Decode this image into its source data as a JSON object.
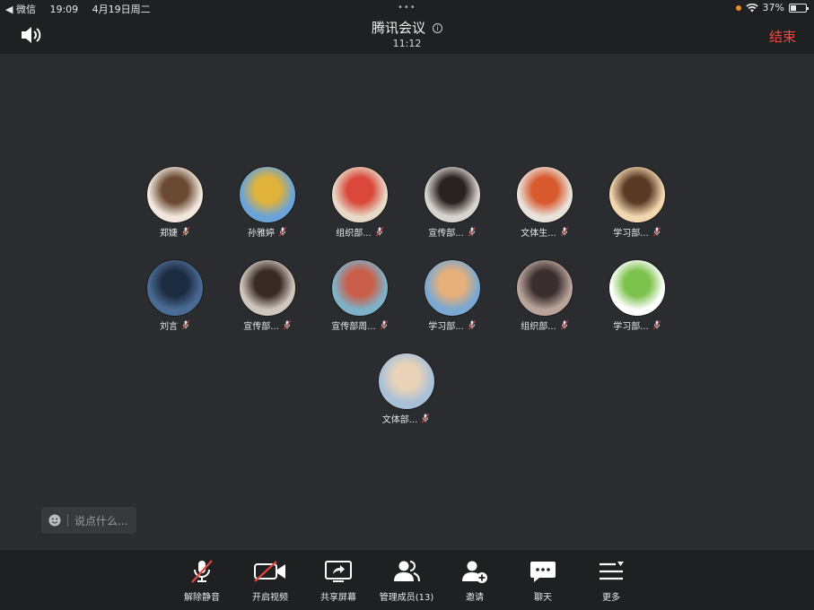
{
  "status_bar": {
    "app": "◀ 微信",
    "time": "19:09",
    "date": "4月19日周二",
    "battery": "37%",
    "battery_level": 0.37
  },
  "header": {
    "title": "腾讯会议",
    "timer": "11:12",
    "end_label": "结束"
  },
  "participants": [
    {
      "name": "郑婕",
      "colors": [
        "#f1e7dc",
        "#6b4a34"
      ]
    },
    {
      "name": "孙雅婷",
      "colors": [
        "#6aa3d8",
        "#e0b23a"
      ]
    },
    {
      "name": "组织部...",
      "colors": [
        "#e8d9c8",
        "#d9483a"
      ]
    },
    {
      "name": "宣传部...",
      "colors": [
        "#d8d4d0",
        "#2a2220"
      ]
    },
    {
      "name": "文体生...",
      "colors": [
        "#e8e2da",
        "#d85a2e"
      ]
    },
    {
      "name": "学习部...",
      "colors": [
        "#f2d7b0",
        "#5a3a24"
      ]
    },
    {
      "name": "刘言",
      "colors": [
        "#4a6b94",
        "#1d2b40"
      ]
    },
    {
      "name": "宣传部...",
      "colors": [
        "#cfc6be",
        "#3a2a24"
      ]
    },
    {
      "name": "宣传部周...",
      "colors": [
        "#7fb2c9",
        "#c95e4a"
      ]
    },
    {
      "name": "学习部...",
      "colors": [
        "#7aa8d2",
        "#e6b07a"
      ]
    },
    {
      "name": "组织部...",
      "colors": [
        "#b9a39a",
        "#3a2f30"
      ]
    },
    {
      "name": "学习部...",
      "colors": [
        "#ffffff",
        "#7cc24c"
      ]
    },
    {
      "name": "文体部...",
      "colors": [
        "#a8c0d8",
        "#e8d2b8"
      ]
    }
  ],
  "chat": {
    "placeholder": "说点什么..."
  },
  "toolbar": {
    "unmute": "解除静音",
    "video": "开启视频",
    "share": "共享屏幕",
    "members": "管理成员(13)",
    "invite": "邀请",
    "chat": "聊天",
    "more": "更多"
  },
  "colors": {
    "background": "#2b2c2f",
    "bar": "#1f2022",
    "end": "#f0493e",
    "muted_red": "#e5483c"
  }
}
